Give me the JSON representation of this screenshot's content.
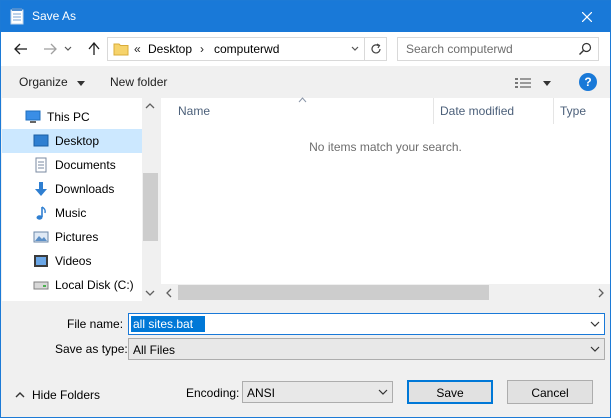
{
  "window": {
    "title": "Save As"
  },
  "address": {
    "prefix": "«",
    "crumbs": [
      "Desktop",
      "computerwd"
    ]
  },
  "search": {
    "placeholder": "Search computerwd"
  },
  "toolbar": {
    "organize": "Organize",
    "new_folder": "New folder",
    "help": "?"
  },
  "nav": {
    "items": [
      {
        "label": "This PC",
        "icon": "pc-icon"
      },
      {
        "label": "Desktop",
        "icon": "desktop-icon",
        "selected": true
      },
      {
        "label": "Documents",
        "icon": "documents-icon"
      },
      {
        "label": "Downloads",
        "icon": "downloads-icon"
      },
      {
        "label": "Music",
        "icon": "music-icon"
      },
      {
        "label": "Pictures",
        "icon": "pictures-icon"
      },
      {
        "label": "Videos",
        "icon": "videos-icon"
      },
      {
        "label": "Local Disk (C:)",
        "icon": "disk-icon"
      }
    ]
  },
  "columns": [
    "Name",
    "Date modified",
    "Type"
  ],
  "content": {
    "empty_message": "No items match your search."
  },
  "form": {
    "file_name_label": "File name:",
    "file_name_value": "all sites.bat",
    "save_type_label": "Save as type:",
    "save_type_value": "All Files",
    "encoding_label": "Encoding:",
    "encoding_value": "ANSI"
  },
  "footer": {
    "hide_folders": "Hide Folders",
    "save": "Save",
    "cancel": "Cancel"
  },
  "colors": {
    "accent": "#1979d8",
    "selection": "#cce8ff",
    "input_highlight": "#0078d7"
  }
}
